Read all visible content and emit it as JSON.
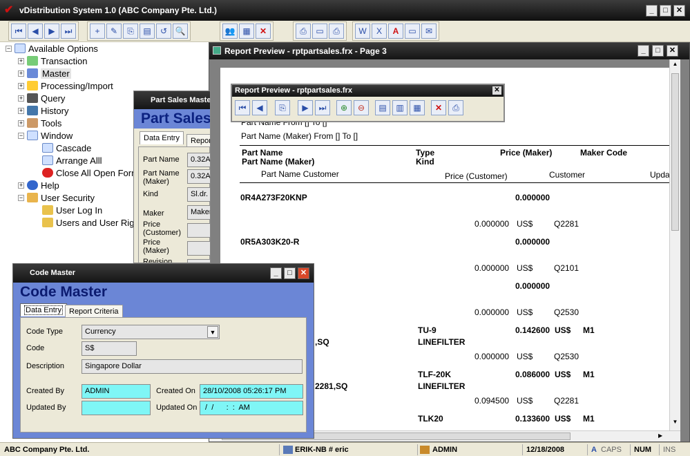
{
  "app": {
    "title": "vDistribution System 1.0 (ABC Company Pte. Ltd.)"
  },
  "tree": {
    "root": "Available Options",
    "items": [
      "Transaction",
      "Master",
      "Processing/Import",
      "Query",
      "History",
      "Tools",
      "Window"
    ],
    "window_children": [
      "Cascade",
      "Arrange Alll",
      "Close All Open Forms"
    ],
    "items2": [
      "Help",
      "User Security"
    ],
    "security_children": [
      "User Log In",
      "Users and User Rights"
    ]
  },
  "report_window": {
    "title": "Report Preview - rptpartsales.frx - Page 3",
    "cut_line": "Part Name From [] To []",
    "filter_line": "Part Name (Maker) From [] To []",
    "headers": {
      "part_name": "Part Name",
      "type": "Type",
      "price_maker": "Price (Maker)",
      "maker_code": "Maker Code",
      "part_name_maker": "Part Name (Maker)",
      "kind": "Kind",
      "part_name_customer": "Part Name Customer",
      "price_customer": "Price (Customer)",
      "customer": "Customer",
      "updated": "Upda"
    },
    "rows": [
      {
        "part": "0R4A273F20KNP",
        "price": "0.000000"
      },
      {
        "pc": "0.000000",
        "cur": "US$",
        "cust": "Q2281"
      },
      {
        "part": "0R5A303K20-R",
        "price": "0.000000"
      },
      {
        "pc": "0.000000",
        "cur": "US$",
        "cust": "Q2101"
      },
      {
        "price": "0.000000"
      },
      {
        "pc": "0.000000",
        "cur": "US$",
        "cust": "Q2530"
      },
      {
        "part": ",SQ",
        "type": "TU-9",
        "kind": "LINEFILTER",
        "price": "0.142600",
        "cur": "US$",
        "maker": "M1"
      },
      {
        "pc": "0.000000",
        "cur": "US$",
        "cust": "Q2530"
      },
      {
        "part": "2281,SQ",
        "type": "TLF-20K",
        "kind": "LINEFILTER",
        "price": "0.086000",
        "cur": "US$",
        "maker": "M1"
      },
      {
        "pc": "0.094500",
        "cur": "US$",
        "cust": "Q2281"
      },
      {
        "type": "TLK20",
        "price": "0.133600",
        "cur": "US$",
        "maker": "M1"
      }
    ]
  },
  "report_toolbar": {
    "title": "Report Preview - rptpartsales.frx"
  },
  "part_sales": {
    "title": "Part Sales Maste",
    "heading": "Part Sales",
    "tab1": "Data Entry",
    "tab2": "Repor",
    "labels": [
      "Part Name",
      "Part Name (Maker)",
      "Kind",
      "Maker",
      "Price (Customer)",
      "Price (Maker)",
      "Revision"
    ],
    "values": [
      "0.32A",
      "0.32A",
      "Sl.dr.",
      "Maker",
      ""
    ]
  },
  "code_master": {
    "title": "Code Master",
    "heading": "Code Master",
    "tab_data_entry": "Data Entry",
    "tab_report_criteria": "Report Criteria",
    "code_type_label": "Code Type",
    "code_type_value": "Currency",
    "code_label": "Code",
    "code_value": "S$",
    "description_label": "Description",
    "description_value": "Singapore Dollar",
    "created_by_label": "Created By",
    "created_by_value": "ADMIN",
    "created_on_label": "Created On",
    "created_on_value": "28/10/2008 05:26:17 PM",
    "updated_by_label": "Updated By",
    "updated_by_value": "",
    "updated_on_label": "Updated On",
    "updated_on_value": " /  /      :  :  AM"
  },
  "status": {
    "company": "ABC Company Pte. Ltd.",
    "machine": "ERIK-NB # eric",
    "user": "ADMIN",
    "date": "12/18/2008",
    "caps": "CAPS",
    "num": "NUM",
    "ins": "INS"
  }
}
